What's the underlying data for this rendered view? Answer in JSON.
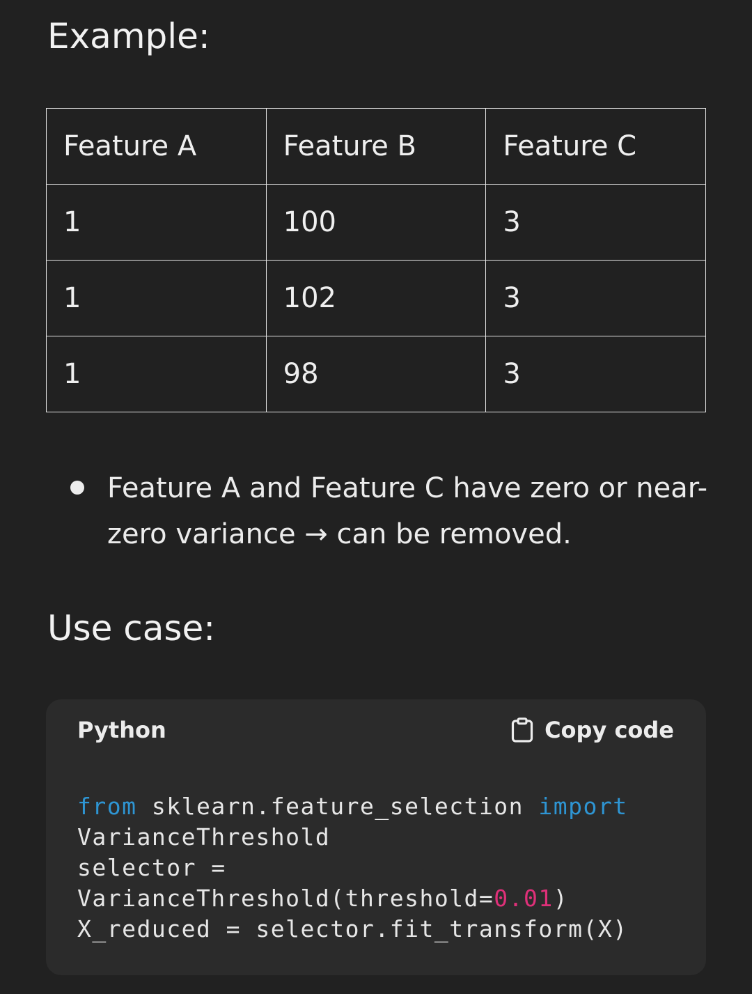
{
  "example_heading": "Example:",
  "table": {
    "headers": [
      "Feature A",
      "Feature B",
      "Feature C"
    ],
    "rows": [
      [
        "1",
        "100",
        "3"
      ],
      [
        "1",
        "102",
        "3"
      ],
      [
        "1",
        "98",
        "3"
      ]
    ]
  },
  "bullets": [
    "Feature A and Feature C have zero or near-zero variance → can be removed."
  ],
  "use_case_heading": "Use case:",
  "code_block": {
    "language": "Python",
    "copy_label": "Copy code",
    "copy_icon": "clipboard-icon",
    "lines": {
      "l1_kw_from": "from",
      "l1_module": " sklearn.feature_selection ",
      "l1_kw_import": "import",
      "l2": "VarianceThreshold",
      "l3": "selector =",
      "l4_pre": "VarianceThreshold(threshold=",
      "l4_num": "0.01",
      "l4_post": ")",
      "l5": "X_reduced = selector.fit_transform(X)"
    },
    "colors": {
      "keyword": "#2e95d3",
      "number": "#df3079"
    }
  },
  "colors": {
    "background": "#212121",
    "code_background": "#2b2b2b",
    "text": "#ececec"
  }
}
